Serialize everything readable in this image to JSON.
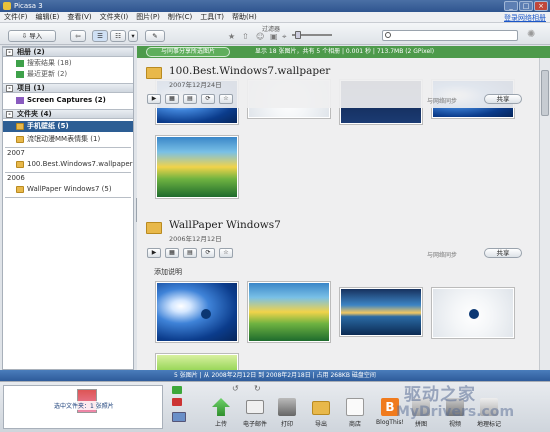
{
  "window": {
    "title": "Picasa 3",
    "minimize": "_",
    "maximize": "□",
    "close": "×"
  },
  "menu": {
    "items": [
      "文件(F)",
      "编辑(E)",
      "查看(V)",
      "文件夹(I)",
      "图片(P)",
      "制作(C)",
      "工具(T)",
      "帮助(H)"
    ],
    "signin": "登录网络相册"
  },
  "toolbar": {
    "import_label": "导入",
    "filter_label": "过滤器",
    "search_placeholder": ""
  },
  "sidebar": {
    "groups": [
      {
        "label": "相册 (2)",
        "items": [
          {
            "label": "搜索结果 (18)"
          },
          {
            "label": "最近更新 (2)"
          }
        ]
      },
      {
        "label": "项目 (1)",
        "items": [
          {
            "label": "Screen Captures (2)"
          }
        ]
      },
      {
        "label": "文件夹 (4)",
        "items": [
          {
            "label": "手机壁纸 (5)"
          },
          {
            "label": "流氓动漫MM表情集 (1)"
          }
        ]
      }
    ],
    "years": [
      {
        "year": "2007",
        "items": [
          {
            "label": "100.Best.Windows7.wallpaper"
          }
        ]
      },
      {
        "year": "2006",
        "items": [
          {
            "label": "WallPaper Windows7 (5)"
          }
        ]
      }
    ]
  },
  "infostrip": {
    "share_label": "与同事分享所选图片",
    "text": "显示 18 张图片，共有 5 个相册 | 0.001 秒 | 713.7MB (2 GPixel)"
  },
  "albums": [
    {
      "title": "100.Best.Windows7.wallpaper",
      "date": "2007年12月24日",
      "share_text": "与网络同步",
      "share_button": "共享"
    },
    {
      "title": "WallPaper Windows7",
      "date": "2006年12月12日",
      "share_text": "与网络同步",
      "share_button": "共享",
      "add_caption": "添加说明"
    }
  ],
  "statusbar": {
    "text": "5 张图片 | 从 2008年2月12日 到 2008年2月18日 | 占用 268KB 磁盘空间"
  },
  "tray": {
    "label": "选中文件夹：1 张照片"
  },
  "bottom_actions": [
    {
      "label": "上传",
      "color": "#3da83a"
    },
    {
      "label": "电子邮件",
      "color": "#e6e6e6"
    },
    {
      "label": "打印",
      "color": "#888888"
    },
    {
      "label": "导出",
      "color": "#e0c06a"
    },
    {
      "label": "商店",
      "color": "#f2f2f2"
    },
    {
      "label": "BlogThis!",
      "color": "#f07b1e"
    },
    {
      "label": "拼图",
      "color": "#c8c8c8"
    },
    {
      "label": "视频",
      "color": "#b0b0b0"
    },
    {
      "label": "地理标记",
      "color": "#d8d8d8"
    }
  ],
  "watermark": {
    "line1": "驱动之家",
    "line2": "MyDrivers.com"
  }
}
